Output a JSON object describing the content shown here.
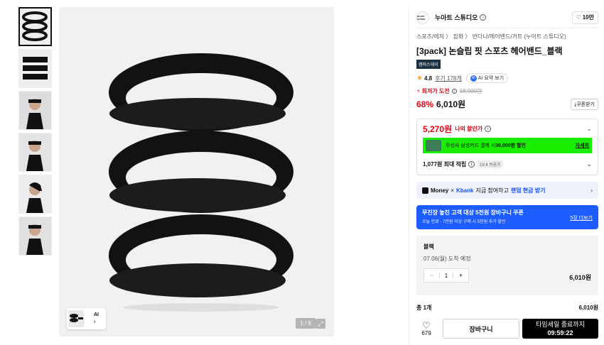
{
  "gallery": {
    "counter": "1 / 6",
    "ai_chip_label": "AI",
    "zoom_icon": "expand-icon"
  },
  "brand": {
    "logo_text": "NUART STUDIO",
    "name": "누아트 스튜디오",
    "likes": "10만"
  },
  "breadcrumb": "스포츠/레저 〉 잡화 〉 반다나/헤어밴드/거트 (누아트 스튜디오)",
  "product": {
    "title": "[3pack] 논슬립 핏 스포츠 헤어밴드_블랙",
    "badge": "캠퍼스데이",
    "rating": "4.8",
    "reviews": "후기 178개",
    "ai_summary": "AI 요약 보기",
    "lowest_label": "최저가 도전",
    "original_price": "18,900원",
    "discount": "68%",
    "price": "6,010원",
    "coupon": "쿠폰받기"
  },
  "my_price": {
    "amount": "5,270원",
    "label": "나의 할인가"
  },
  "card_promo": {
    "text": "무신사 삼성카드 결제 시 ",
    "bold": "30,000원 할인",
    "more": "자세히"
  },
  "points": {
    "text": "1,077원 최대 적립",
    "level": "LV.4 브론즈"
  },
  "money_banner": {
    "money": "Money",
    "x": "×",
    "kbank": "Kbank",
    "text": "지금 참여하고",
    "link": "랜덤 현금 받기"
  },
  "blue_banner": {
    "title": "무진장 놓친 고객 대상 5천원 장바구니 쿠폰",
    "sub": "오늘 만료 · 7만원 이상 구매 시 5천원 추가 할인",
    "more": "5장 더보기"
  },
  "option": {
    "color": "블랙",
    "delivery": "07.06(월) 도착 예정",
    "qty": "1",
    "price": "6,010원",
    "minus": "−",
    "plus": "+"
  },
  "total": {
    "label": "총 1개",
    "value": "6,010원"
  },
  "actions": {
    "like_count": "679",
    "cart": "장바구니",
    "buy_line1": "타임세일 종료까지",
    "buy_time": "09:59:22"
  }
}
